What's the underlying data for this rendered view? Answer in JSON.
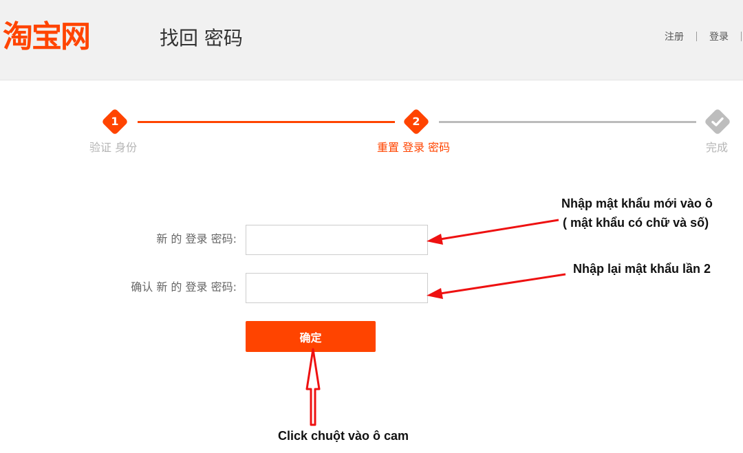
{
  "header": {
    "logo": "淘宝网",
    "title": "找回 密码",
    "links": {
      "register": "注册",
      "login": "登录"
    }
  },
  "steps": [
    {
      "number": "1",
      "label": "验证 身份",
      "state": "done"
    },
    {
      "number": "2",
      "label": "重置 登录 密码",
      "state": "active"
    },
    {
      "number": "",
      "label": "完成",
      "state": "pending"
    }
  ],
  "form": {
    "new_password_label": "新 的 登录 密码:",
    "new_password_value": "",
    "confirm_password_label": "确认 新 的 登录 密码:",
    "confirm_password_value": "",
    "submit_label": "确定"
  },
  "annotations": {
    "new_password_line1": "Nhập mật khẩu mới vào ô",
    "new_password_line2": "( mật khẩu có chữ và số)",
    "confirm_password": "Nhập lại mật khẩu lần 2",
    "submit": "Click chuột vào ô cam"
  },
  "colors": {
    "accent": "#ff4400",
    "header_bg": "#f1f1f1",
    "pending": "#bbbbbb",
    "arrow": "#ee1111"
  }
}
